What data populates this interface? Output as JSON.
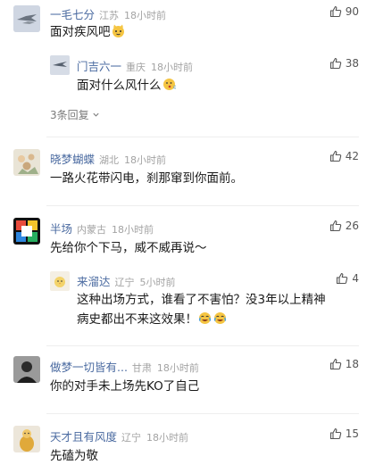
{
  "comments": [
    {
      "user": "一毛七分",
      "location": "江苏",
      "time": "18小时前",
      "text": "面对疾风吧",
      "emoji": "cat-face-emoji",
      "likes": "90",
      "replies": [
        {
          "user": "门吉六一",
          "location": "重庆",
          "time": "18小时前",
          "text": "面对什么风什么",
          "emoji": "blowing-face-emoji",
          "likes": "38"
        }
      ],
      "more_replies": "3条回复"
    },
    {
      "user": "晓梦蝴蝶",
      "location": "湖北",
      "time": "18小时前",
      "text": "一路火花带闪电，刹那窜到你面前。",
      "likes": "42"
    },
    {
      "user": "半场",
      "location": "内蒙古",
      "time": "18小时前",
      "text": "先给你个下马，威不威再说～",
      "likes": "26",
      "replies": [
        {
          "user": "来溜达",
          "location": "辽宁",
          "time": "5小时前",
          "text_line1": "这种出场方式，谁看了不害怕？没3年以上精神",
          "text_line2": "病史都出不来这效果！",
          "emoji": "crying-laughing-emoji",
          "likes": "4"
        }
      ]
    },
    {
      "user": "做梦一切皆有...",
      "location": "甘肃",
      "time": "18小时前",
      "text": "你的对手未上场先KO了自己",
      "likes": "18"
    },
    {
      "user": "天才且有风度",
      "location": "辽宁",
      "time": "18小时前",
      "text": "先磕为敬",
      "likes": "15"
    }
  ],
  "colors": {
    "username": "#4a6aa0",
    "meta": "#a3a3a3",
    "text": "#1a1a1a"
  }
}
